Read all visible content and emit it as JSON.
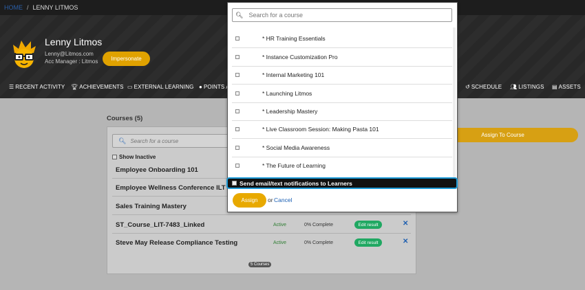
{
  "breadcrumb": {
    "home": "HOME",
    "separator": "/",
    "current": "LENNY LITMOS"
  },
  "profile": {
    "name": "Lenny Litmos",
    "email": "Lenny@Litmos.com",
    "role": "Acc Manager : Litmos",
    "impersonate_label": "Impersonate"
  },
  "nav": {
    "recent_activity": "RECENT ACTIVITY",
    "achievements": "ACHIEVEMENTS",
    "external_learning": "EXTERNAL LEARNING",
    "points": "POINTS A",
    "schedule": "SCHEDULE",
    "listings": "LISTINGS",
    "assets": "ASSETS"
  },
  "courses": {
    "title": "Courses (5)",
    "search_placeholder": "Search for a course",
    "show_inactive": "Show Inactive",
    "rows": [
      {
        "name": "Employee Onboarding 101"
      },
      {
        "name": "Employee Wellness Conference ILT"
      },
      {
        "name": "Sales Training Mastery"
      },
      {
        "name": "ST_Course_LIT-7483_Linked",
        "status": "Active",
        "progress": "0% Complete",
        "edit_label": "Edit result"
      },
      {
        "name": "Steve May Release Compliance Testing",
        "status": "Active",
        "progress": "0% Complete",
        "edit_label": "Edit result"
      }
    ],
    "count_badge": "5 Courses",
    "assign_to_course_label": "Assign To Course"
  },
  "modal": {
    "search_placeholder": "Search for a course",
    "items": [
      {
        "label": "* HR Training Essentials"
      },
      {
        "label": "* Instance Customization Pro"
      },
      {
        "label": "* Internal Marketing 101"
      },
      {
        "label": "* Launching Litmos"
      },
      {
        "label": "* Leadership Mastery"
      },
      {
        "label": "* Live Classroom Session: Making Pasta 101"
      },
      {
        "label": "* Social Media Awareness"
      },
      {
        "label": "* The Future of Learning"
      }
    ],
    "notify_label": "Send email/text notifications to Learners",
    "assign_label": "Assign",
    "or_text": "or",
    "cancel_label": "Cancel"
  },
  "colors": {
    "accent": "#e8a900",
    "link": "#1a5fb4",
    "focus_ring": "#1e9bd7",
    "status_green": "#20a862"
  }
}
